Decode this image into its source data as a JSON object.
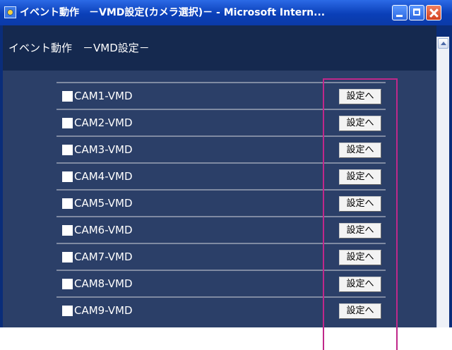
{
  "window": {
    "title": "イベント動作　－VMD設定(カメラ選択)－ - Microsoft Intern..."
  },
  "page": {
    "heading": "イベント動作　－VMD設定－"
  },
  "cameras": [
    {
      "label": "CAM1-VMD",
      "button": "設定へ"
    },
    {
      "label": "CAM2-VMD",
      "button": "設定へ"
    },
    {
      "label": "CAM3-VMD",
      "button": "設定へ"
    },
    {
      "label": "CAM4-VMD",
      "button": "設定へ"
    },
    {
      "label": "CAM5-VMD",
      "button": "設定へ"
    },
    {
      "label": "CAM6-VMD",
      "button": "設定へ"
    },
    {
      "label": "CAM7-VMD",
      "button": "設定へ"
    },
    {
      "label": "CAM8-VMD",
      "button": "設定へ"
    },
    {
      "label": "CAM9-VMD",
      "button": "設定へ"
    }
  ],
  "colors": {
    "titlebar": "#0a3fb8",
    "header_bg": "#15294f",
    "content_bg": "#2b3f68",
    "highlight": "#c0288a"
  }
}
